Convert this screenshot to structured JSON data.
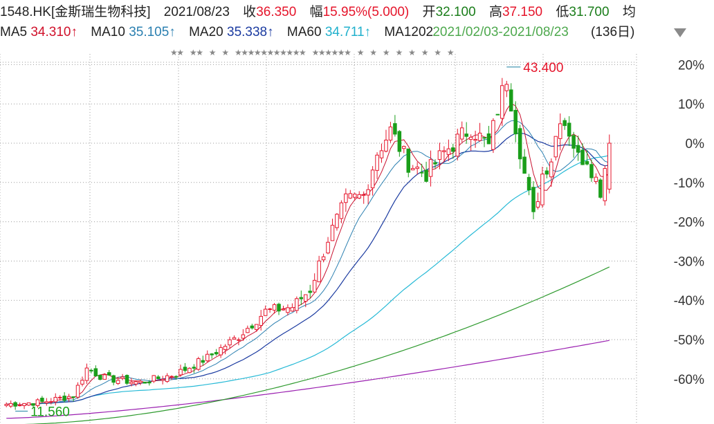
{
  "header": {
    "code": "1548.HK",
    "name": "[金斯瑞生物科技]",
    "date": "2021/08/23",
    "close_label": "收",
    "close_value": "36.350",
    "change_label": "幅",
    "change_value": "15.95%(5.000)",
    "open_label": "开",
    "open_value": "32.100",
    "high_label": "高",
    "high_value": "37.150",
    "low_label": "低",
    "low_value": "31.700",
    "avg_label": "均"
  },
  "ma_row": {
    "ma5_label": "MA5",
    "ma5_value": "34.310↑",
    "ma10_label": "MA10",
    "ma10_value": "35.105↑",
    "ma20_label": "MA20",
    "ma20_value": "35.338↑",
    "ma60_label": "MA60",
    "ma60_value": "34.711↑",
    "ma120_overlap_text": "MA1202",
    "range_text": "2021/02/03-2021/08/23",
    "days_text": "(136日)"
  },
  "colors": {
    "up": "#e5142a",
    "down": "#1a9e1a",
    "ma5": "#c8102e",
    "ma10": "#2a7fb0",
    "ma20": "#1a3aa0",
    "ma60": "#25b9d6",
    "ma120": "#2e9a2e",
    "ma250": "#9a1fb0",
    "grid": "#9a9a9a"
  },
  "chart_data": {
    "type": "candlestick",
    "y_axis_labels": [
      "20%",
      "10%",
      "0%",
      "-10%",
      "-20%",
      "-30%",
      "-40%",
      "-50%",
      "-60%"
    ],
    "ylim_percent": [
      -66,
      22
    ],
    "base_price": 36.35,
    "annotations": [
      {
        "text": "43.400",
        "type": "high"
      },
      {
        "text": "11.560",
        "type": "low"
      }
    ],
    "marker_glyph": "★",
    "star_rows": [
      "★★ ★★ ★ ★ ★★★★★★★★★★★ ★★★★★★ ★ ★ ★ ★ ★ ★ ★ ★"
    ],
    "n_candles": 136,
    "closes_keypoints": [
      [
        0,
        12.2
      ],
      [
        8,
        12.4
      ],
      [
        15,
        13.0
      ],
      [
        18,
        15.5
      ],
      [
        22,
        14.6
      ],
      [
        30,
        14.2
      ],
      [
        38,
        15.0
      ],
      [
        45,
        16.5
      ],
      [
        52,
        18.5
      ],
      [
        58,
        20.8
      ],
      [
        64,
        21.2
      ],
      [
        68,
        22.8
      ],
      [
        72,
        27.5
      ],
      [
        76,
        31.0
      ],
      [
        80,
        31.5
      ],
      [
        83,
        35.5
      ],
      [
        86,
        37.5
      ],
      [
        90,
        34.5
      ],
      [
        94,
        33.5
      ],
      [
        98,
        35.5
      ],
      [
        104,
        37.8
      ],
      [
        108,
        36.0
      ],
      [
        110,
        39.5
      ],
      [
        112,
        42.5
      ],
      [
        114,
        38.0
      ],
      [
        116,
        33.5
      ],
      [
        118,
        29.5
      ],
      [
        120,
        33.5
      ],
      [
        122,
        35.0
      ],
      [
        124,
        39.0
      ],
      [
        126,
        37.5
      ],
      [
        128,
        35.0
      ],
      [
        130,
        35.0
      ],
      [
        133,
        32.0
      ],
      [
        135,
        36.35
      ]
    ],
    "ma_series": [
      {
        "name": "MA5",
        "value": 34.31
      },
      {
        "name": "MA10",
        "value": 35.105
      },
      {
        "name": "MA20",
        "value": 35.338
      },
      {
        "name": "MA60",
        "value": 34.711
      },
      {
        "name": "MA120"
      },
      {
        "name": "MA250"
      }
    ],
    "grid": true
  }
}
